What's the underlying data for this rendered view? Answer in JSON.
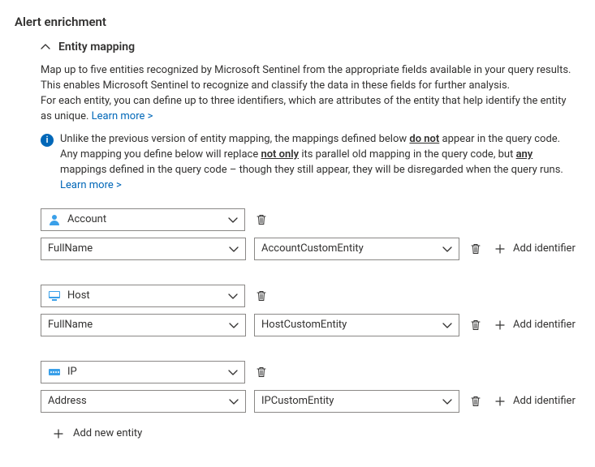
{
  "header": {
    "title": "Alert enrichment"
  },
  "section": {
    "title": "Entity mapping",
    "description_line1": "Map up to five entities recognized by Microsoft Sentinel from the appropriate fields available in your query results.",
    "description_line2": "This enables Microsoft Sentinel to recognize and classify the data in these fields for further analysis.",
    "description_line3": "For each entity, you can define up to three identifiers, which are attributes of the entity that help identify the entity as unique.",
    "learn_more": "Learn more >"
  },
  "info": {
    "text_pre": "Unlike the previous version of entity mapping, the mappings defined below ",
    "bold1": "do not",
    "text_mid1": " appear in the query code. Any mapping you define below will replace ",
    "bold2": "not only",
    "text_mid2": " its parallel old mapping in the query code, but ",
    "bold3": "any",
    "text_mid3": " mappings defined in the query code – though they still appear, they will be disregarded when the query runs. ",
    "learn_more": "Learn more >"
  },
  "entities": [
    {
      "type": "Account",
      "icon": "account",
      "identifiers": [
        {
          "attr": "FullName",
          "value": "AccountCustomEntity"
        }
      ]
    },
    {
      "type": "Host",
      "icon": "host",
      "identifiers": [
        {
          "attr": "FullName",
          "value": "HostCustomEntity"
        }
      ]
    },
    {
      "type": "IP",
      "icon": "ip",
      "identifiers": [
        {
          "attr": "Address",
          "value": "IPCustomEntity"
        }
      ]
    }
  ],
  "labels": {
    "add_identifier": "Add identifier",
    "add_entity": "Add new entity"
  }
}
